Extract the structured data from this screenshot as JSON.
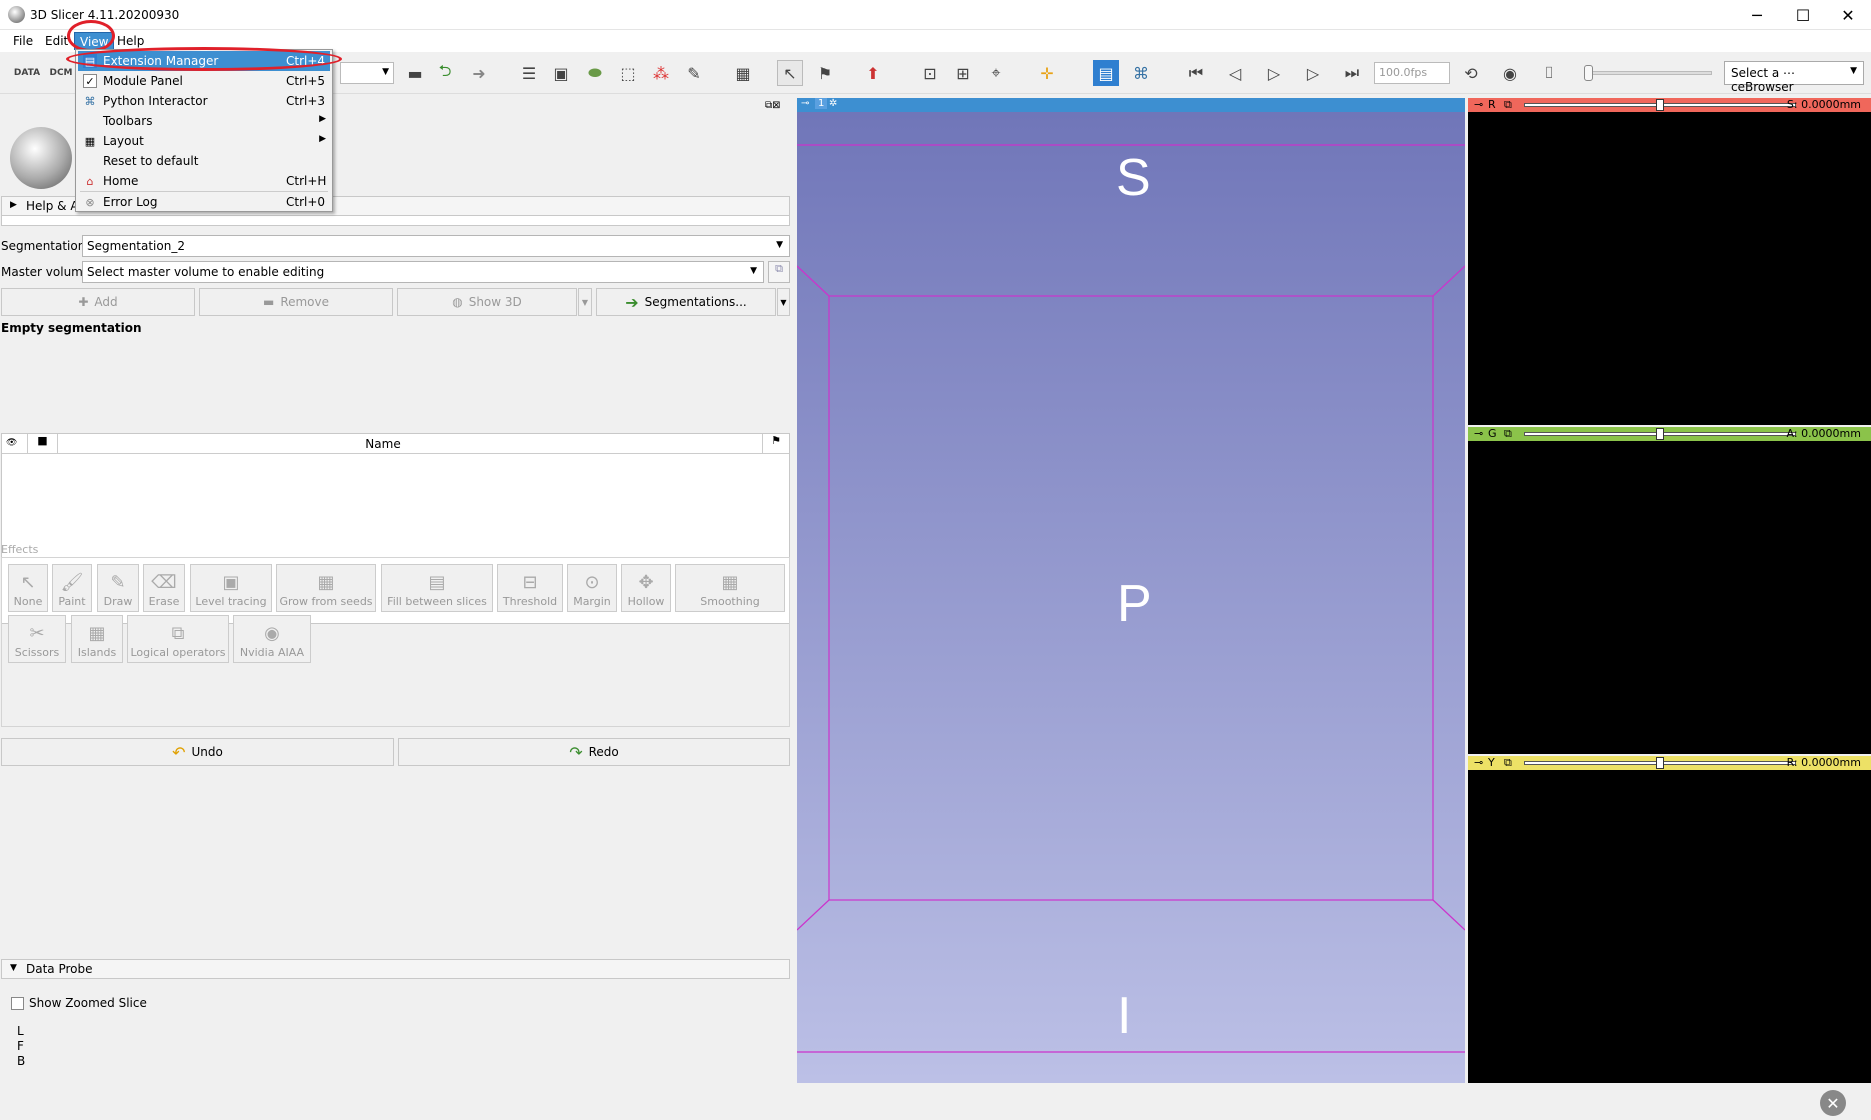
{
  "window": {
    "title": "3D Slicer 4.11.20200930",
    "minimize": "─",
    "maximize": "☐",
    "close": "✕"
  },
  "menubar": {
    "items": [
      "File",
      "Edit",
      "View",
      "Help"
    ]
  },
  "toolbar": {
    "data_label": "DATA",
    "dcm_label": "DCM",
    "fps": "100.0fps",
    "select_browser": "Select a ⋯ceBrowser"
  },
  "view_menu": {
    "items": [
      {
        "label": "Extension Manager",
        "shortcut": "Ctrl+4",
        "icon": "extension-icon",
        "highlighted": true
      },
      {
        "label": "Module Panel",
        "shortcut": "Ctrl+5",
        "icon": "check-icon"
      },
      {
        "label": "Python Interactor",
        "shortcut": "Ctrl+3",
        "icon": "python-icon"
      },
      {
        "label": "Toolbars",
        "shortcut": "",
        "icon": "",
        "submenu": true
      },
      {
        "label": "Layout",
        "shortcut": "",
        "icon": "layout-icon",
        "submenu": true
      },
      {
        "label": "Reset to default",
        "shortcut": "",
        "icon": ""
      },
      {
        "label": "Home",
        "shortcut": "Ctrl+H",
        "icon": "home-icon"
      },
      {
        "label": "Error Log",
        "shortcut": "Ctrl+0",
        "icon": "error-icon"
      }
    ]
  },
  "module": {
    "help_label": "Help & Ac",
    "segmentation_label": "Segmentation:",
    "segmentation_value": "Segmentation_2",
    "master_volume_label": "Master volume:",
    "master_volume_value": "Select master volume to enable editing",
    "add_button": "Add",
    "remove_button": "Remove",
    "show3d_button": "Show 3D",
    "segmentations_button": "Segmentations...",
    "empty_label": "Empty segmentation",
    "table_name_header": "Name",
    "effects_label": "Effects",
    "effects_row1": [
      "None",
      "Paint",
      "Draw",
      "Erase",
      "Level tracing",
      "Grow from seeds",
      "Fill between slices",
      "Threshold",
      "Margin",
      "Hollow",
      "Smoothing"
    ],
    "effects_row2": [
      "Scissors",
      "Islands",
      "Logical operators",
      "Nvidia AIAA"
    ],
    "undo_button": "Undo",
    "redo_button": "Redo"
  },
  "data_probe": {
    "title": "Data Probe",
    "show_zoomed": "Show Zoomed Slice",
    "lines": [
      "L",
      "F",
      "B"
    ]
  },
  "view3d": {
    "number": "1",
    "top": "S",
    "center": "P",
    "bottom": "I"
  },
  "slices": [
    {
      "letter": "R",
      "readout": "S: 0.0000mm",
      "color": "#f0675b"
    },
    {
      "letter": "G",
      "readout": "A: 0.0000mm",
      "color": "#8bc34a"
    },
    {
      "letter": "Y",
      "readout": "R: 0.0000mm",
      "color": "#ede166"
    }
  ]
}
